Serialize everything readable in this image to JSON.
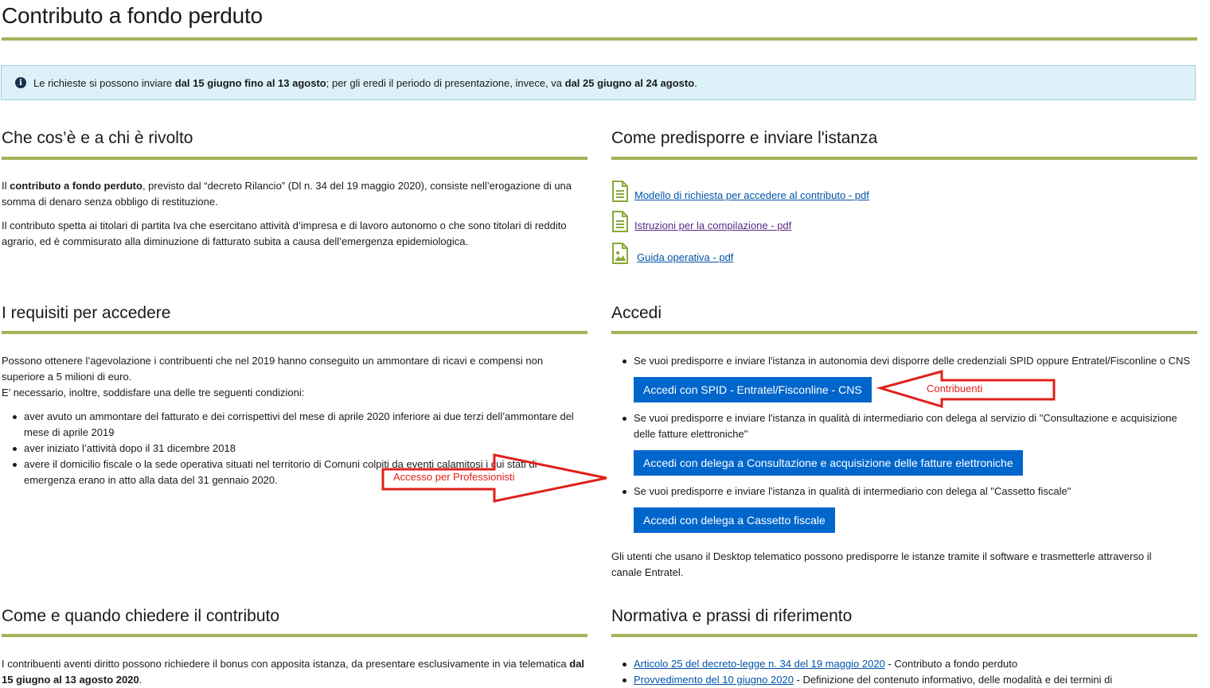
{
  "page": {
    "title": "Contributo a fondo perduto"
  },
  "info": {
    "text_1": "Le richieste si possono inviare ",
    "bold_1": "dal 15 giugno fino al 13 agosto",
    "text_2": "; per gli eredi il periodo di presentazione, invece, va ",
    "bold_2": "dal 25 giugno al 24 agosto",
    "text_3": "."
  },
  "cosa": {
    "title": "Che cos’è e a chi è rivolto",
    "p1_pre": "Il ",
    "p1_bold": "contributo a fondo perduto",
    "p1_post": ", previsto dal “decreto Rilancio” (Dl n. 34 del 19 maggio 2020), consiste nell’erogazione di una somma di denaro senza obbligo di restituzione.",
    "p2": "Il contributo spetta ai titolari di partita Iva che esercitano attività d’impresa e di lavoro autonomo o che sono titolari di reddito agrario, ed è commisurato alla diminuzione di fatturato subita a causa dell’emergenza epidemiologica."
  },
  "istanza": {
    "title": "Come predisporre e inviare l'istanza",
    "links": [
      {
        "label": "Modello di richiesta per accedere al contributo - pdf"
      },
      {
        "label": "Istruzioni per la compilazione - pdf"
      },
      {
        "label": "Guida operativa - pdf"
      }
    ]
  },
  "requisiti": {
    "title": "I requisiti per accedere",
    "intro_1": "Possono ottenere l’agevolazione i contribuenti che nel 2019 hanno conseguito un ammontare di ricavi e compensi non superiore a 5 milioni di euro.",
    "intro_2": "E’ necessario, inoltre, soddisfare una delle tre seguenti condizioni:",
    "items": [
      "aver avuto un ammontare del fatturato e dei corrispettivi del mese di aprile 2020 inferiore ai due terzi dell’ammontare del mese di aprile 2019",
      "aver iniziato l’attività dopo il 31 dicembre 2018",
      "avere il domicilio fiscale o la sede operativa situati nel territorio di Comuni colpiti da eventi calamitosi i cui stati di emergenza erano in atto alla data del 31 gennaio 2020."
    ]
  },
  "accedi": {
    "title": "Accedi",
    "item_1": "Se vuoi predisporre e inviare l'istanza in autonomia devi disporre delle credenziali SPID oppure Entratel/Fisconline o CNS",
    "button_1": "Accedi con SPID - Entratel/Fisconline - CNS",
    "item_2": "Se vuoi predisporre e inviare l'istanza in qualità di intermediario con delega al servizio di \"Consultazione e acquisizione delle fatture elettroniche\"",
    "button_2": "Accedi con delega a Consultazione e acquisizione delle fatture elettroniche",
    "item_3": "Se vuoi predisporre e inviare l'istanza in qualità di intermediario con delega al \"Cassetto fiscale\"",
    "button_3": "Accedi con delega a Cassetto fiscale",
    "desktop_note": "Gli utenti che usano il Desktop telematico possono predisporre le istanze tramite il software e trasmetterle attraverso il canale Entratel."
  },
  "annotations": {
    "contribuenti": "Contribuenti",
    "professionisti": "Accesso per Professionisti",
    "color": "#e0201b"
  },
  "quando": {
    "title": "Come e quando chiedere il contributo",
    "p1": "I contribuenti aventi diritto possono richiedere il bonus con apposita istanza, da presentare esclusivamente in via telematica",
    "p1_bold": "dal 15 giugno al 13 agosto 2020",
    "p1_end": "."
  },
  "normativa": {
    "title": "Normativa e prassi di riferimento",
    "item_1_link": "Articolo 25 del decreto-legge n. 34 del 19 maggio 2020",
    "item_1_text": " - Contributo a fondo perduto",
    "item_2_link": "Provvedimento del 10 giugno 2020",
    "item_2_text": " - Definizione del contenuto informativo, delle modalità e dei termini di"
  },
  "colors": {
    "accent_rule": "#a3b35a",
    "button": "#0066cc",
    "link": "#0055a8",
    "info_bg": "#ddf2f8"
  }
}
